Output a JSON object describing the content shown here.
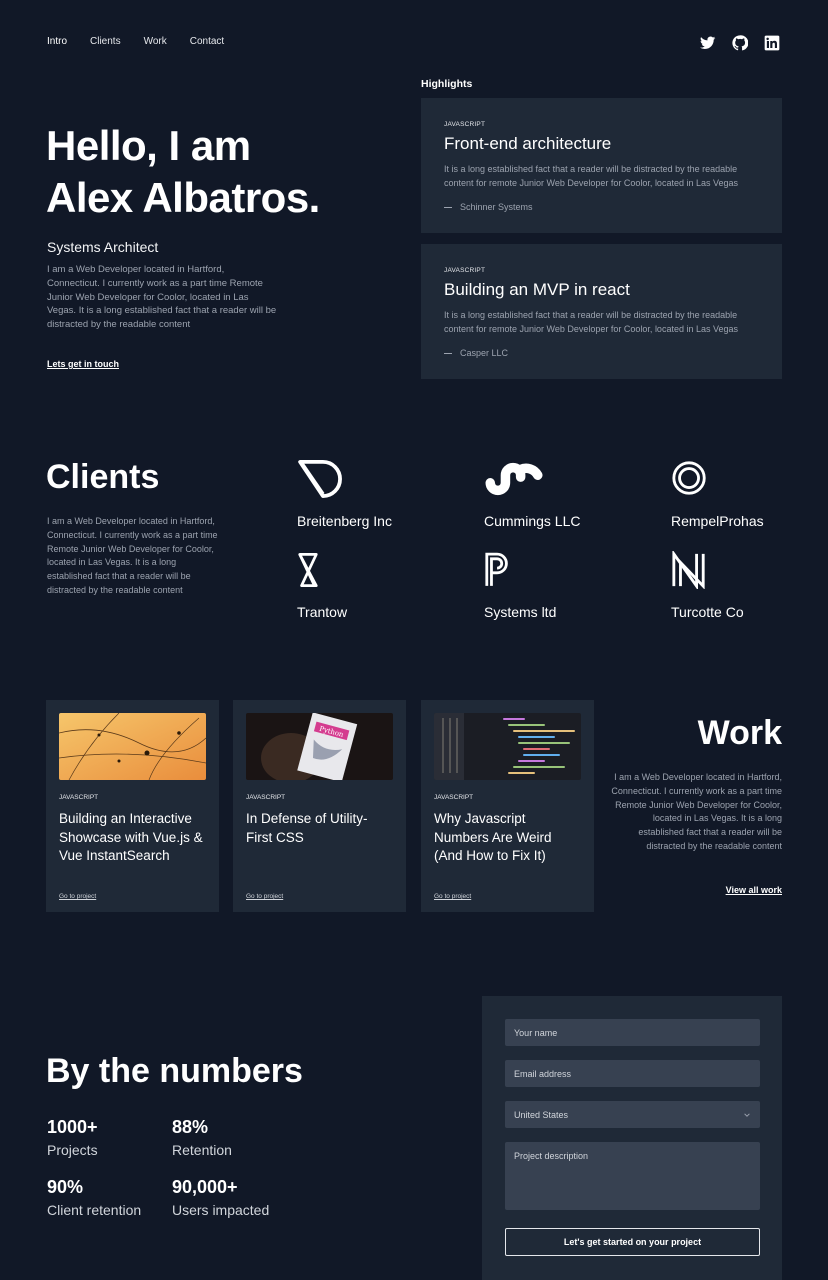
{
  "nav": {
    "items": [
      "Intro",
      "Clients",
      "Work",
      "Contact"
    ]
  },
  "social": {
    "icons": [
      "twitter-icon",
      "github-icon",
      "linkedin-icon"
    ]
  },
  "hero": {
    "title_line1": "Hello, I am",
    "title_line2": "Alex Albatros.",
    "role": "Systems Architect",
    "description": "I am a Web Developer located in Hartford, Connecticut. I currently work as a part time Remote Junior Web Developer for Coolor, located in Las Vegas. It is a long established fact that a reader will be distracted by the readable content",
    "cta": "Lets get in touch"
  },
  "highlights": {
    "heading": "Highlights",
    "items": [
      {
        "tag": "JAVASCRIPT",
        "title": "Front-end architecture",
        "text": "It is a long established fact that a reader will be distracted by the readable content for remote Junior Web Developer for Coolor, located in Las Vegas",
        "company": "Schinner Systems"
      },
      {
        "tag": "JAVASCRIPT",
        "title": "Building an MVP in react",
        "text": "It is a long established fact that a reader will be distracted by the readable content for remote Junior Web Developer for Coolor, located in Las Vegas",
        "company": "Casper LLC"
      }
    ]
  },
  "clients": {
    "heading": "Clients",
    "description": "I am a Web Developer located in Hartford, Connecticut. I currently work as a part time Remote Junior Web Developer for Coolor, located in Las Vegas. It is a long established fact that a reader will be distracted by the readable content",
    "items": [
      {
        "name": "Breitenberg Inc",
        "icon": "breitenberg-logo-icon"
      },
      {
        "name": "Cummings LLC",
        "icon": "cummings-logo-icon"
      },
      {
        "name": "RempelProhas",
        "icon": "rempelprohas-logo-icon"
      },
      {
        "name": "Trantow",
        "icon": "trantow-logo-icon"
      },
      {
        "name": "Systems ltd",
        "icon": "systems-logo-icon"
      },
      {
        "name": "Turcotte Co",
        "icon": "turcotte-logo-icon"
      }
    ]
  },
  "work": {
    "heading": "Work",
    "description": "I am a Web Developer located in Hartford, Connecticut. I currently work as a part time Remote Junior Web Developer for Coolor, located in Las Vegas. It is a long established fact that a reader will be distracted by the readable content",
    "view_all": "View all work",
    "projects": [
      {
        "tag": "JAVASCRIPT",
        "title": "Building an Interactive Showcase with Vue.js & Vue InstantSearch",
        "link": "Go to project",
        "image": "dewdrop-web-photo"
      },
      {
        "tag": "JAVASCRIPT",
        "title": "In Defense of Utility-First CSS",
        "link": "Go to project",
        "image": "python-book-photo"
      },
      {
        "tag": "JAVASCRIPT",
        "title": "Why Javascript Numbers Are Weird (And How to Fix It)",
        "link": "Go to project",
        "image": "code-screen-photo"
      }
    ]
  },
  "numbers": {
    "heading": "By the numbers",
    "stats": [
      {
        "value": "1000+",
        "label": "Projects"
      },
      {
        "value": "88%",
        "label": "Retention"
      },
      {
        "value": "90%",
        "label": "Client retention"
      },
      {
        "value": "90,000+",
        "label": "Users impacted"
      }
    ]
  },
  "form": {
    "name_placeholder": "Your name",
    "email_placeholder": "Email address",
    "country_value": "United States",
    "description_placeholder": "Project description",
    "submit": "Let's get started on your project"
  },
  "colors": {
    "background": "#111827",
    "card": "#1f2937",
    "field": "#374151",
    "muted_text": "#9ca3af"
  }
}
